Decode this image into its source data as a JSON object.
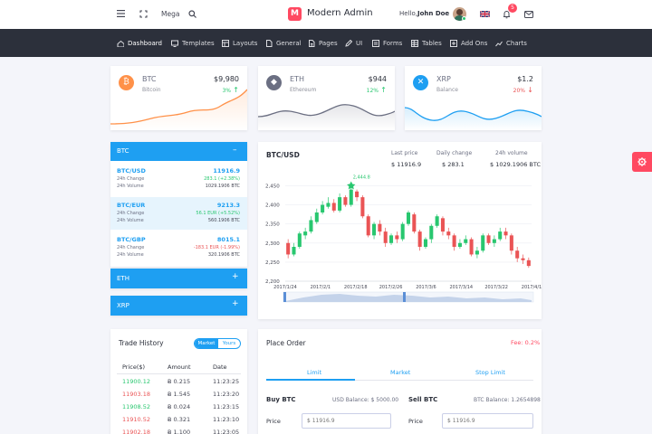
{
  "topbar": {
    "mega_label": "Mega",
    "brand_letter": "M",
    "brand_name": "Modern Admin",
    "greeting": "Hello,",
    "user_name": "John Doe",
    "notification_count": "5"
  },
  "nav": [
    {
      "label": "Dashboard",
      "icon": "home-icon"
    },
    {
      "label": "Templates",
      "icon": "monitor-icon"
    },
    {
      "label": "Layouts",
      "icon": "layout-icon"
    },
    {
      "label": "General",
      "icon": "file-icon"
    },
    {
      "label": "Pages",
      "icon": "pages-icon"
    },
    {
      "label": "UI",
      "icon": "pen-icon"
    },
    {
      "label": "Forms",
      "icon": "forms-icon"
    },
    {
      "label": "Tables",
      "icon": "table-icon"
    },
    {
      "label": "Add Ons",
      "icon": "addons-icon"
    },
    {
      "label": "Charts",
      "icon": "chart-icon"
    }
  ],
  "stats": [
    {
      "symbol": "BTC",
      "name": "Bitcoin",
      "price": "$9,980",
      "change": "3%",
      "direction": "up",
      "color": "#ff9149"
    },
    {
      "symbol": "ETH",
      "name": "Ethereum",
      "price": "$944",
      "change": "12%",
      "direction": "up",
      "color": "#6b6f82"
    },
    {
      "symbol": "XRP",
      "name": "Balance",
      "price": "$1.2",
      "change": "20%",
      "direction": "down",
      "color": "#1e9ff2"
    }
  ],
  "market": {
    "btc_header": "BTC",
    "btc_toggle": "–",
    "rows": [
      {
        "pair": "BTC/USD",
        "price": "11916.9",
        "l1": "24h Change",
        "v1": "283.1 (+2.38%)",
        "v1_color": "green",
        "l2": "24h Volume",
        "v2": "1029.1906 BTC"
      },
      {
        "pair": "BTC/EUR",
        "price": "9213.3",
        "l1": "24h Change",
        "v1": "56.1 EUR (+5.52%)",
        "v1_color": "green",
        "l2": "24h Volume",
        "v2": "560.1906 BTC"
      },
      {
        "pair": "BTC/GBP",
        "price": "8015.1",
        "l1": "24h Change",
        "v1": "-183.1 EUR (-1.99%)",
        "v1_color": "red",
        "l2": "24h Volume",
        "v2": "320.1906 BTC"
      }
    ],
    "eth_header": "ETH",
    "eth_toggle": "+",
    "xrp_header": "XRP",
    "xrp_toggle": "+"
  },
  "chart_panel": {
    "title": "BTC/USD",
    "stats": [
      {
        "label": "Last price",
        "value": "$ 11916.9"
      },
      {
        "label": "Daily change",
        "value": "$ 283.1"
      },
      {
        "label": "24h volume",
        "value": "$ 1029.1906 BTC"
      }
    ]
  },
  "chart_data": {
    "type": "candlestick",
    "y_ticks": [
      "2,450",
      "2,400",
      "2,350",
      "2,300",
      "2,250",
      "2,200"
    ],
    "ylim": [
      2200,
      2470
    ],
    "x_ticks": [
      "2017/1/24",
      "2017/2/1",
      "2017/2/18",
      "2017/2/26",
      "2017/3/6",
      "2017/3/14",
      "2017/3/22",
      "2017/4/1"
    ],
    "annotation": "2,444.8",
    "grid": true,
    "candles": [
      [
        2300,
        2270,
        2310,
        2260
      ],
      [
        2270,
        2290,
        2300,
        2265
      ],
      [
        2290,
        2325,
        2330,
        2285
      ],
      [
        2320,
        2330,
        2340,
        2310
      ],
      [
        2330,
        2360,
        2370,
        2325
      ],
      [
        2355,
        2380,
        2390,
        2350
      ],
      [
        2380,
        2400,
        2410,
        2375
      ],
      [
        2395,
        2405,
        2420,
        2390
      ],
      [
        2405,
        2385,
        2415,
        2380
      ],
      [
        2385,
        2420,
        2430,
        2380
      ],
      [
        2420,
        2400,
        2425,
        2395
      ],
      [
        2400,
        2440,
        2445,
        2395
      ],
      [
        2435,
        2420,
        2440,
        2410
      ],
      [
        2420,
        2370,
        2425,
        2365
      ],
      [
        2370,
        2320,
        2375,
        2315
      ],
      [
        2320,
        2350,
        2355,
        2310
      ],
      [
        2350,
        2330,
        2360,
        2320
      ],
      [
        2330,
        2300,
        2340,
        2290
      ],
      [
        2300,
        2320,
        2325,
        2295
      ],
      [
        2320,
        2310,
        2330,
        2300
      ],
      [
        2310,
        2350,
        2355,
        2305
      ],
      [
        2350,
        2380,
        2385,
        2345
      ],
      [
        2375,
        2330,
        2380,
        2325
      ],
      [
        2330,
        2290,
        2335,
        2280
      ],
      [
        2290,
        2310,
        2315,
        2285
      ],
      [
        2310,
        2345,
        2350,
        2300
      ],
      [
        2345,
        2370,
        2375,
        2340
      ],
      [
        2365,
        2330,
        2370,
        2320
      ],
      [
        2330,
        2320,
        2340,
        2310
      ],
      [
        2320,
        2290,
        2325,
        2280
      ],
      [
        2290,
        2300,
        2310,
        2285
      ],
      [
        2300,
        2310,
        2320,
        2295
      ],
      [
        2310,
        2270,
        2315,
        2265
      ],
      [
        2270,
        2280,
        2290,
        2260
      ],
      [
        2280,
        2320,
        2325,
        2275
      ],
      [
        2320,
        2300,
        2325,
        2295
      ],
      [
        2300,
        2310,
        2320,
        2290
      ],
      [
        2310,
        2330,
        2340,
        2305
      ],
      [
        2330,
        2320,
        2340,
        2310
      ],
      [
        2320,
        2280,
        2325,
        2270
      ],
      [
        2280,
        2260,
        2290,
        2250
      ],
      [
        2260,
        2255,
        2270,
        2245
      ],
      [
        2255,
        2240,
        2262,
        2235
      ]
    ]
  },
  "trade_history": {
    "title": "Trade History",
    "tab_market": "Market",
    "tab_yours": "Yours",
    "headers": [
      "Price($)",
      "Amount",
      "Date"
    ],
    "rows": [
      {
        "price": "11900.12",
        "color": "green",
        "amount": "Ƀ 0.215",
        "date": "11:23:25"
      },
      {
        "price": "11903.18",
        "color": "red",
        "amount": "Ƀ 1.545",
        "date": "11:23:20"
      },
      {
        "price": "11908.52",
        "color": "green",
        "amount": "Ƀ 0.024",
        "date": "11:23:15"
      },
      {
        "price": "11910.52",
        "color": "red",
        "amount": "Ƀ 0.321",
        "date": "11:23:10"
      },
      {
        "price": "11902.18",
        "color": "red",
        "amount": "Ƀ 1.100",
        "date": "11:23:05"
      }
    ]
  },
  "place_order": {
    "title": "Place Order",
    "fee": "Fee: 0.2%",
    "tabs": [
      "Limit",
      "Market",
      "Stop Limit"
    ],
    "buy_title": "Buy BTC",
    "buy_balance": "USD Balance: $ 5000.00",
    "sell_title": "Sell BTC",
    "sell_balance": "BTC Balance: 1.2654898",
    "price_label": "Price",
    "price_placeholder": "$ 11916.9"
  }
}
